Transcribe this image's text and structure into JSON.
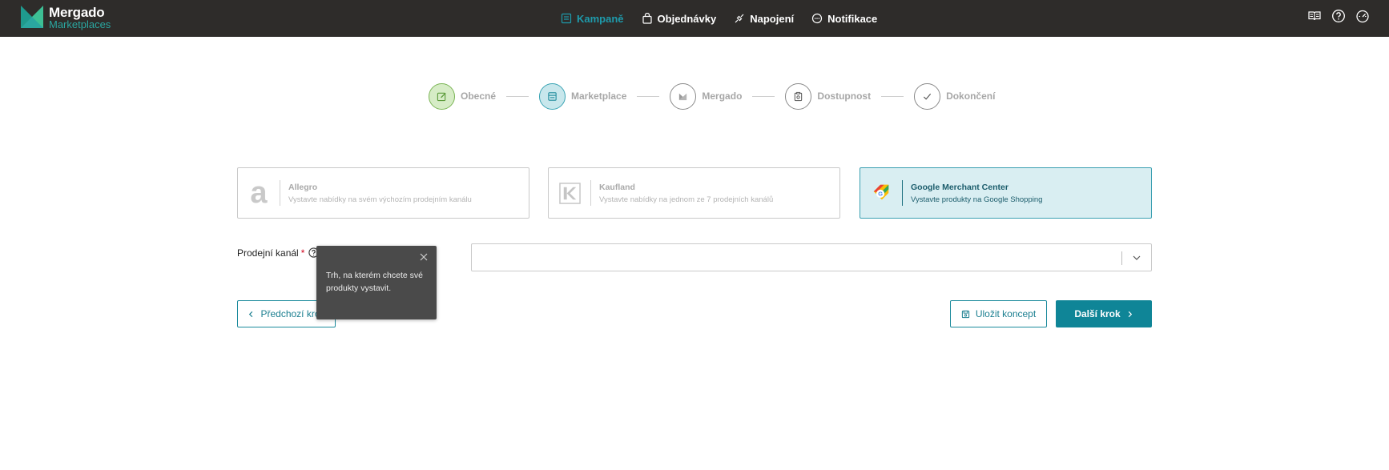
{
  "brand": {
    "name": "Mergado",
    "sub": "Marketplaces"
  },
  "nav": [
    {
      "label": "Kampaně",
      "icon": "campaign-icon"
    },
    {
      "label": "Objednávky",
      "icon": "bag-icon"
    },
    {
      "label": "Napojení",
      "icon": "plug-icon"
    },
    {
      "label": "Notifikace",
      "icon": "chat-icon"
    }
  ],
  "topicons": [
    "book-icon",
    "help-circle-icon",
    "dashboard-icon"
  ],
  "steps": [
    {
      "label": "Obecné",
      "state": "done"
    },
    {
      "label": "Marketplace",
      "state": "current"
    },
    {
      "label": "Mergado",
      "state": "todo"
    },
    {
      "label": "Dostupnost",
      "state": "todo"
    },
    {
      "label": "Dokončení",
      "state": "todo"
    }
  ],
  "cards": [
    {
      "title": "Allegro",
      "desc": "Vystavte nabídky na svém výchozím prodejním kanálu"
    },
    {
      "title": "Kaufland",
      "desc": "Vystavte nabídky na jednom ze 7 prodejních kanálů"
    },
    {
      "title": "Google Merchant Center",
      "desc": "Vystavte produkty na Google Shopping",
      "selected": true
    }
  ],
  "form": {
    "label": "Prodejní kanál",
    "required_mark": "*"
  },
  "tooltip": {
    "text": "Trh, na kterém chcete své produkty vystavit."
  },
  "buttons": {
    "prev": "Předchozí krok",
    "save": "Uložit koncept",
    "next": "Další krok"
  },
  "colors": {
    "accent": "#0f8597",
    "topbar": "#2e2c2a",
    "done": "#7bb556"
  }
}
